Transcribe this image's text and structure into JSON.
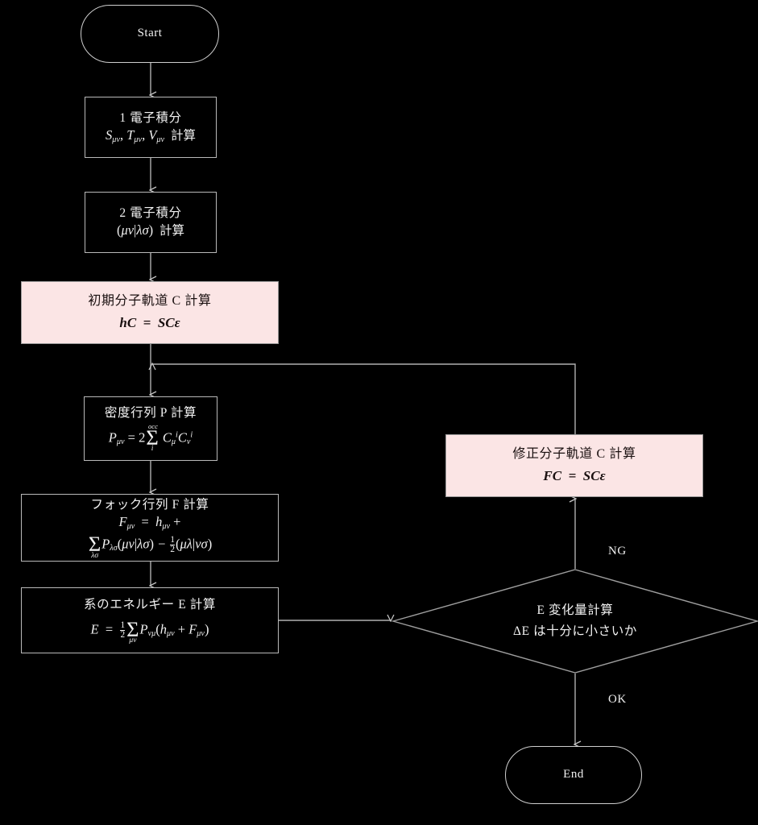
{
  "diagram": {
    "title": "Hartree-Fock SCF flowchart",
    "background_color": "#000000",
    "line_color": "#b9b9b9",
    "text_color": "#f2f2f2",
    "highlight_fill": "#fbe5e5",
    "highlight_text_color": "#1a1010"
  },
  "nodes": {
    "start": {
      "label": "Start",
      "shape": "terminator"
    },
    "one_electron_integral": {
      "line1": "1 電子積分",
      "line2_plain": "Sμν, Tμν, Vμν 計算",
      "suffix": "計算",
      "shape": "process"
    },
    "two_electron_integral": {
      "line1": "2 電子積分",
      "line2_plain": "(μν|λσ) 計算",
      "suffix": "計算",
      "shape": "process"
    },
    "initial_mo": {
      "line1": "初期分子軌道 C 計算",
      "line2_plain": "hC = SCϵ",
      "shape": "process",
      "fill": "#fbe5e5"
    },
    "density_matrix": {
      "line1": "密度行列 P 計算",
      "line2_plain": "Pμν = 2 Σi^occ Cμ^i Cν^i",
      "shape": "process"
    },
    "fock_matrix": {
      "line1": "フォック行列 F 計算",
      "line2_plain": "Fμν = hμν +",
      "line3_plain": "Σλσ Pλσ(μν|λσ) − ½(μλ|νσ)",
      "shape": "process"
    },
    "energy": {
      "line1": "系のエネルギー E 計算",
      "line2_plain": "E = ½ Σμν Pνμ(hμν + Fμν)",
      "shape": "process"
    },
    "new_mo": {
      "line1": "修正分子軌道 C 計算",
      "line2_plain": "FC = SCϵ",
      "shape": "process",
      "fill": "#fbe5e5"
    },
    "convergence_check": {
      "line1": "E 変化量計算",
      "line2": "ΔE は十分に小さいか",
      "shape": "decision"
    },
    "end": {
      "label": "End",
      "shape": "terminator"
    }
  },
  "edge_labels": {
    "ng": "NG",
    "ok": "OK"
  },
  "math_tokens": {
    "S": "S",
    "T": "T",
    "V": "V",
    "h": "h",
    "C": "C",
    "P": "P",
    "F": "F",
    "E": "E",
    "S_ovl": "S",
    "eps": "ϵ",
    "mu": "μ",
    "nu": "ν",
    "lambda": "λ",
    "sigma": "σ",
    "i": "i",
    "occ": "occ",
    "delta": "Δ",
    "eq": "=",
    "plus": "+",
    "minus": "−",
    "bar": "|",
    "paren_l": "(",
    "paren_r": ")",
    "two": "2",
    "one": "1",
    "comma": ",",
    "keisan": "計算"
  }
}
